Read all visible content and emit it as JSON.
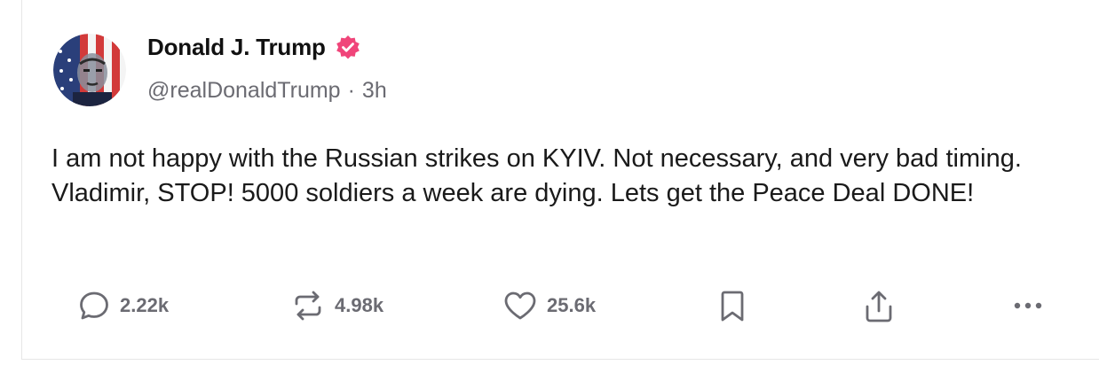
{
  "post": {
    "author_name": "Donald J. Trump",
    "handle": "@realDonaldTrump",
    "separator": "·",
    "time_ago": "3h",
    "verified_color": "#f0457a",
    "text": "I am not happy with the Russian strikes on KYIV. Not necessary, and very bad timing. Vladimir, STOP! 5000 soldiers a week are dying. Lets get the Peace Deal DONE!"
  },
  "actions": {
    "replies": {
      "icon": "comment-icon",
      "count": "2.22k"
    },
    "reposts": {
      "icon": "repost-icon",
      "count": "4.98k"
    },
    "likes": {
      "icon": "heart-icon",
      "count": "25.6k"
    },
    "bookmark": {
      "icon": "bookmark-icon"
    },
    "share": {
      "icon": "share-icon"
    },
    "more": {
      "icon": "more-icon"
    }
  },
  "colors": {
    "icon_gray": "#6b6b72",
    "text": "#1a1a1a"
  }
}
